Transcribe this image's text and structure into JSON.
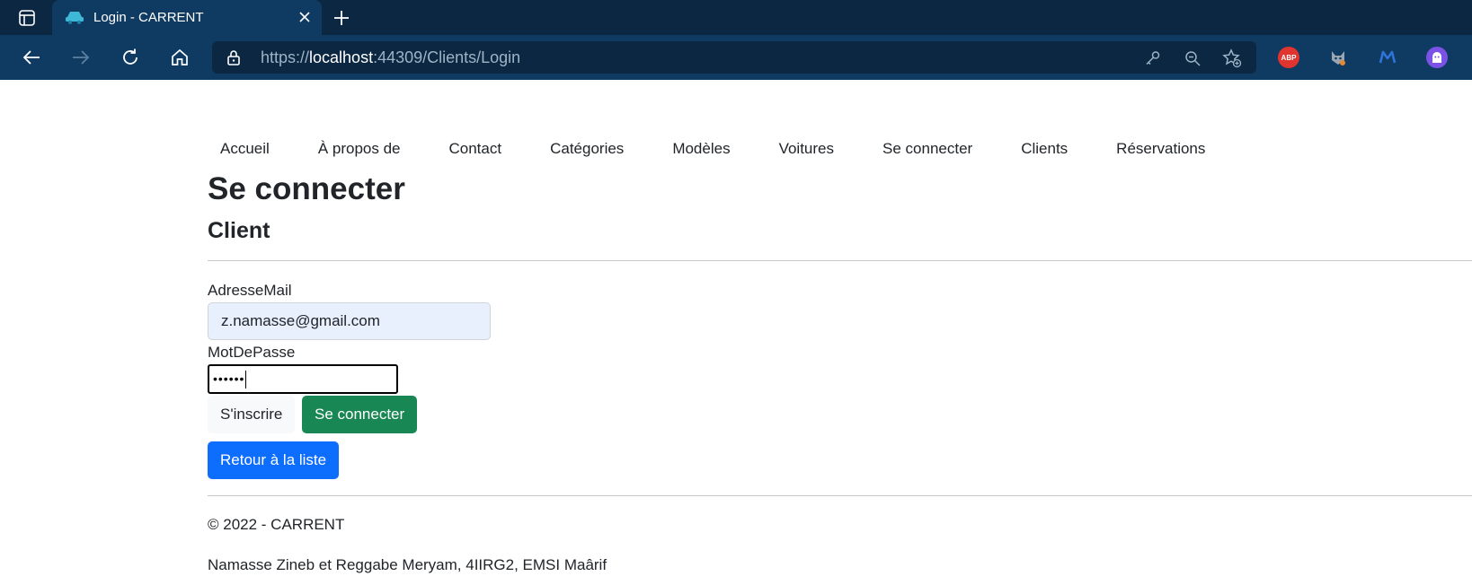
{
  "browser": {
    "tab_title": "Login - CARRENT",
    "url_scheme": "https://",
    "url_host": "localhost",
    "url_rest": ":44309/Clients/Login",
    "extensions": [
      {
        "name": "adblock-plus",
        "label": "ABP",
        "color": "#e0342f"
      },
      {
        "name": "extension-fox",
        "label": "",
        "color": "#9aa6b2"
      },
      {
        "name": "malwarebytes",
        "label": "",
        "color": "#2f73d8"
      },
      {
        "name": "extension-ghost",
        "label": "",
        "color": "#7b52e6"
      }
    ]
  },
  "nav": {
    "items": [
      "Accueil",
      "À propos de",
      "Contact",
      "Catégories",
      "Modèles",
      "Voitures",
      "Se connecter",
      "Clients",
      "Réservations"
    ]
  },
  "page": {
    "title": "Se connecter",
    "subtitle": "Client"
  },
  "form": {
    "email_label": "AdresseMail",
    "email_value": "z.namasse@gmail.com",
    "password_label": "MotDePasse",
    "password_value": "••••••",
    "register_button": "S'inscrire",
    "login_button": "Se connecter",
    "back_button": "Retour à la liste"
  },
  "footer": {
    "copyright": "© 2022 - CARRENT",
    "authors": "Namasse Zineb et Reggabe Meryam, 4IIRG2, EMSI Maârif"
  },
  "colors": {
    "chrome_dark": "#0b2742",
    "chrome": "#0f3b62",
    "success": "#198754",
    "primary": "#0d6efd"
  }
}
